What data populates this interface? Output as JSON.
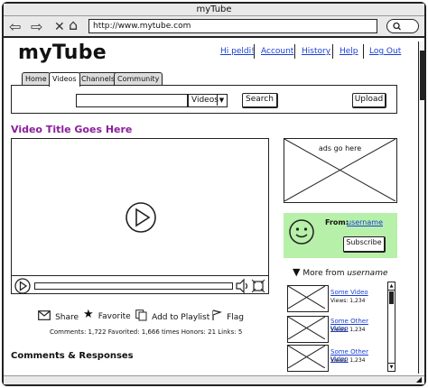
{
  "window": {
    "title": "myTube",
    "url": "http://www.mytube.com"
  },
  "site": {
    "logo": "myTube"
  },
  "user_links": [
    "Hi peldi!",
    "Account",
    "History",
    "Help",
    "Log Out"
  ],
  "tabs": [
    {
      "label": "Home"
    },
    {
      "label": "Videos",
      "active": true
    },
    {
      "label": "Channels"
    },
    {
      "label": "Community"
    }
  ],
  "search": {
    "value": "",
    "category": "Videos",
    "button": "Search",
    "upload": "Upload"
  },
  "video": {
    "title": "Video Title Goes Here"
  },
  "actions": [
    "Share",
    "Favorite",
    "Add to Playlist",
    "Flag"
  ],
  "stats": "Comments: 1,722  Favorited: 1,666 times  Honors: 21  Links: 5",
  "comments_heading": "Comments & Responses",
  "ads": {
    "label": "ads go here"
  },
  "from": {
    "label": "From:",
    "username": "username",
    "subscribe": "Subscribe"
  },
  "more_from": {
    "prefix": "More from",
    "username": "username"
  },
  "related": [
    {
      "title": "Some Video",
      "views": "Views: 1,234"
    },
    {
      "title": "Some Other Video",
      "views": "Views: 1,234"
    },
    {
      "title": "Some Other Video",
      "views": "Views: 1,234"
    }
  ],
  "colors": {
    "video_title": "#8a1f9a",
    "link": "#1a3fd6",
    "from_bg": "#b7f0a8"
  }
}
